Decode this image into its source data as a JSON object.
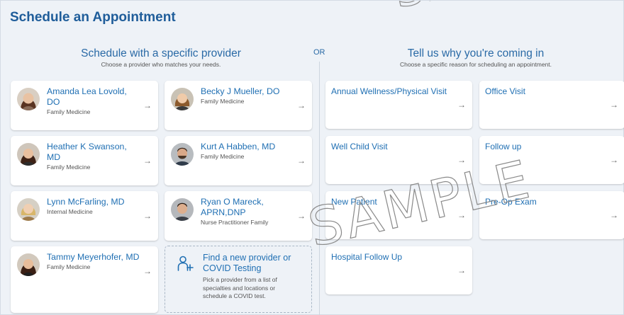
{
  "page": {
    "title": "Schedule an Appointment"
  },
  "provider_section": {
    "heading": "Schedule with a specific provider",
    "subheading": "Choose a provider who matches your needs."
  },
  "or_label": "OR",
  "reason_section": {
    "heading": "Tell us why you're coming in",
    "subheading": "Choose a specific reason for scheduling an appointment."
  },
  "providers": [
    {
      "name": "Amanda Lea Lovold, DO",
      "specialty": "Family Medicine"
    },
    {
      "name": "Becky J Mueller, DO",
      "specialty": "Family Medicine"
    },
    {
      "name": "Heather K Swanson, MD",
      "specialty": "Family Medicine"
    },
    {
      "name": "Kurt A Habben, MD",
      "specialty": "Family Medicine"
    },
    {
      "name": "Lynn McFarling, MD",
      "specialty": "Internal Medicine"
    },
    {
      "name": "Ryan O Mareck, APRN,DNP",
      "specialty": "Nurse Practitioner Family"
    },
    {
      "name": "Tammy Meyerhofer, MD",
      "specialty": "Family Medicine"
    }
  ],
  "find_provider": {
    "title": "Find a new provider or COVID Testing",
    "description": "Pick a provider from a list of specialties and locations or schedule a COVID test."
  },
  "reasons": [
    {
      "label": "Annual Wellness/Physical Visit"
    },
    {
      "label": "Office Visit"
    },
    {
      "label": "Well Child Visit"
    },
    {
      "label": "Follow up"
    },
    {
      "label": "New Patient"
    },
    {
      "label": "Pre-Op Exam"
    },
    {
      "label": "Hospital Follow Up"
    }
  ],
  "arrow_glyph": "→",
  "icons": {
    "find_provider": "person-plus-icon",
    "arrow": "arrow-right-icon"
  },
  "watermark": "SAMPLE",
  "colors": {
    "link": "#1f6fb3",
    "heading": "#2a6aa6",
    "background": "#eef2f7"
  }
}
